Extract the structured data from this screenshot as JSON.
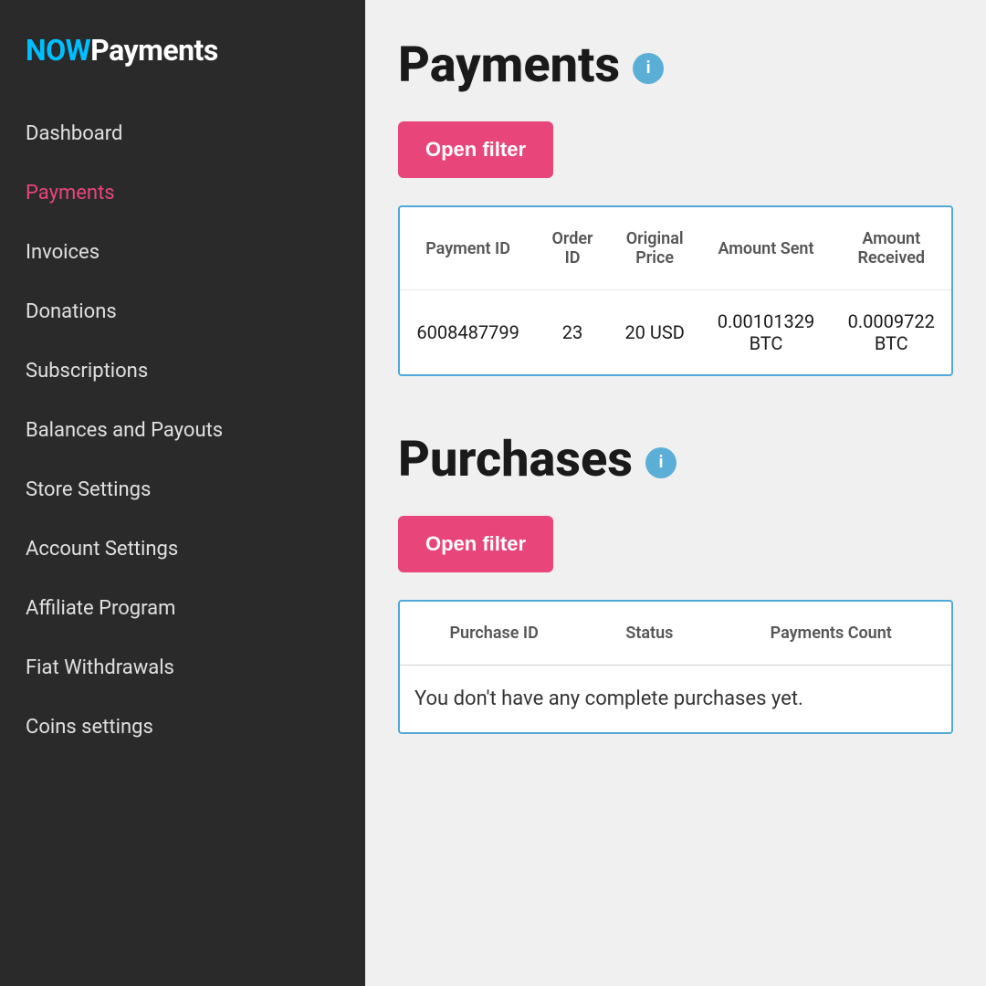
{
  "logo": {
    "now": "NOW",
    "payments": "Payments"
  },
  "nav": {
    "items": [
      {
        "id": "dashboard",
        "label": "Dashboard",
        "active": false
      },
      {
        "id": "payments",
        "label": "Payments",
        "active": true
      },
      {
        "id": "invoices",
        "label": "Invoices",
        "active": false
      },
      {
        "id": "donations",
        "label": "Donations",
        "active": false
      },
      {
        "id": "subscriptions",
        "label": "Subscriptions",
        "active": false
      },
      {
        "id": "balances-payouts",
        "label": "Balances and Payouts",
        "active": false
      },
      {
        "id": "store-settings",
        "label": "Store Settings",
        "active": false
      },
      {
        "id": "account-settings",
        "label": "Account Settings",
        "active": false
      },
      {
        "id": "affiliate-program",
        "label": "Affiliate Program",
        "active": false
      },
      {
        "id": "fiat-withdrawals",
        "label": "Fiat Withdrawals",
        "active": false
      },
      {
        "id": "coins-settings",
        "label": "Coins settings",
        "active": false
      }
    ]
  },
  "payments_section": {
    "title": "Payments",
    "info_icon_label": "i",
    "open_filter_label": "Open filter",
    "table": {
      "columns": [
        "Payment ID",
        "Order ID",
        "Original Price",
        "Amount Sent",
        "Amount Received"
      ],
      "rows": [
        {
          "payment_id": "6008487799",
          "order_id": "23",
          "original_price": "20 USD",
          "amount_sent": "0.00101329 BTC",
          "amount_received": "0.0009722 BTC"
        }
      ]
    }
  },
  "purchases_section": {
    "title": "Purchases",
    "info_icon_label": "i",
    "open_filter_label": "Open filter",
    "table": {
      "columns": [
        "Purchase ID",
        "Status",
        "Payments Count"
      ],
      "rows": []
    },
    "empty_message": "You don't have any complete purchases yet."
  }
}
